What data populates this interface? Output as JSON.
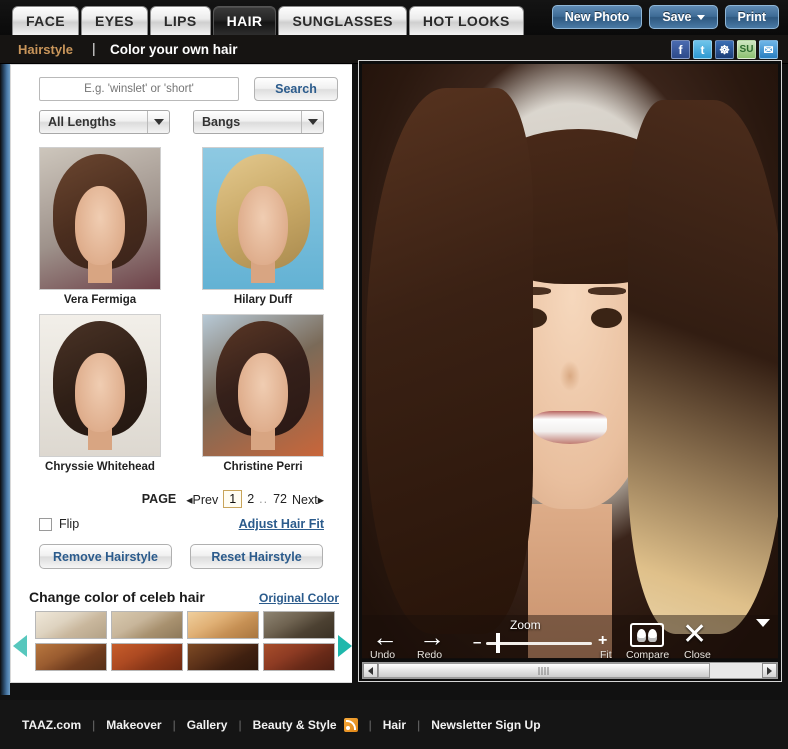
{
  "nav": {
    "tabs": [
      {
        "label": "FACE",
        "active": false
      },
      {
        "label": "EYES",
        "active": false
      },
      {
        "label": "LIPS",
        "active": false
      },
      {
        "label": "HAIR",
        "active": true
      },
      {
        "label": "SUNGLASSES",
        "active": false
      },
      {
        "label": "HOT LOOKS",
        "active": false
      }
    ],
    "buttons": {
      "new_photo": "New Photo",
      "save": "Save",
      "print": "Print"
    }
  },
  "subheader": {
    "breadcrumb_active": "Hairstyle",
    "separator": "|",
    "title": "Color your own hair",
    "social": [
      {
        "name": "facebook-icon",
        "glyph": "f"
      },
      {
        "name": "twitter-icon",
        "glyph": "t"
      },
      {
        "name": "myspace-icon",
        "glyph": "☸"
      },
      {
        "name": "stumbleupon-icon",
        "glyph": "SU"
      },
      {
        "name": "email-icon",
        "glyph": "✉"
      }
    ]
  },
  "sidebar": {
    "search": {
      "placeholder": "E.g. 'winslet' or 'short'",
      "value": "",
      "button_label": "Search"
    },
    "filters": [
      {
        "name": "length-select",
        "label": "All Lengths"
      },
      {
        "name": "bangs-select",
        "label": "Bangs"
      }
    ],
    "thumbnails": [
      {
        "caption": "Vera Fermiga"
      },
      {
        "caption": "Hilary Duff"
      },
      {
        "caption": "Chryssie Whitehead"
      },
      {
        "caption": "Christine Perri"
      }
    ],
    "pagination": {
      "label": "PAGE",
      "prev": "◂Prev",
      "pages": [
        "1",
        "2"
      ],
      "current": "1",
      "dots": "..",
      "last": "72",
      "next": "Next▸"
    },
    "flip": {
      "label": "Flip",
      "checked": false
    },
    "adjust_link": "Adjust Hair Fit",
    "actions": {
      "remove": "Remove Hairstyle",
      "reset": "Reset Hairstyle"
    },
    "color_section": {
      "title": "Change color of celeb hair",
      "original_link": "Original Color",
      "swatches": [
        {
          "name": "swatch-platinum-blonde",
          "color": "#ded3c0"
        },
        {
          "name": "swatch-ash-blonde",
          "color": "#c8b69b"
        },
        {
          "name": "swatch-golden-blonde",
          "color": "#e0b075"
        },
        {
          "name": "swatch-dark-ash",
          "color": "#6e6250"
        },
        {
          "name": "swatch-light-auburn",
          "color": "#9a5c30"
        },
        {
          "name": "swatch-copper-red",
          "color": "#ad4a22"
        },
        {
          "name": "swatch-dark-brown",
          "color": "#5d3219"
        },
        {
          "name": "swatch-mahogany",
          "color": "#8d3b23"
        }
      ],
      "prev_arrow": "prev-colors-arrow",
      "next_arrow": "next-colors-arrow"
    }
  },
  "photo_toolbar": {
    "back_icon": "←",
    "forward_icon": "→",
    "zoom_label": "Zoom",
    "minus": "–",
    "plus": "+",
    "zoom_value": 10,
    "compare_icon": "compare-faces-icon",
    "close_icon": "✕",
    "sub_labels": [
      "Undo",
      "Redo",
      "Fit",
      "Compare",
      "Close"
    ]
  },
  "footer": {
    "links": [
      {
        "label": "TAAZ.com",
        "rss": false
      },
      {
        "label": "Makeover",
        "rss": false
      },
      {
        "label": "Gallery",
        "rss": false
      },
      {
        "label": "Beauty & Style",
        "rss": true
      },
      {
        "label": "Hair",
        "rss": false
      },
      {
        "label": "Newsletter Sign Up",
        "rss": false
      }
    ],
    "separator": "|"
  }
}
